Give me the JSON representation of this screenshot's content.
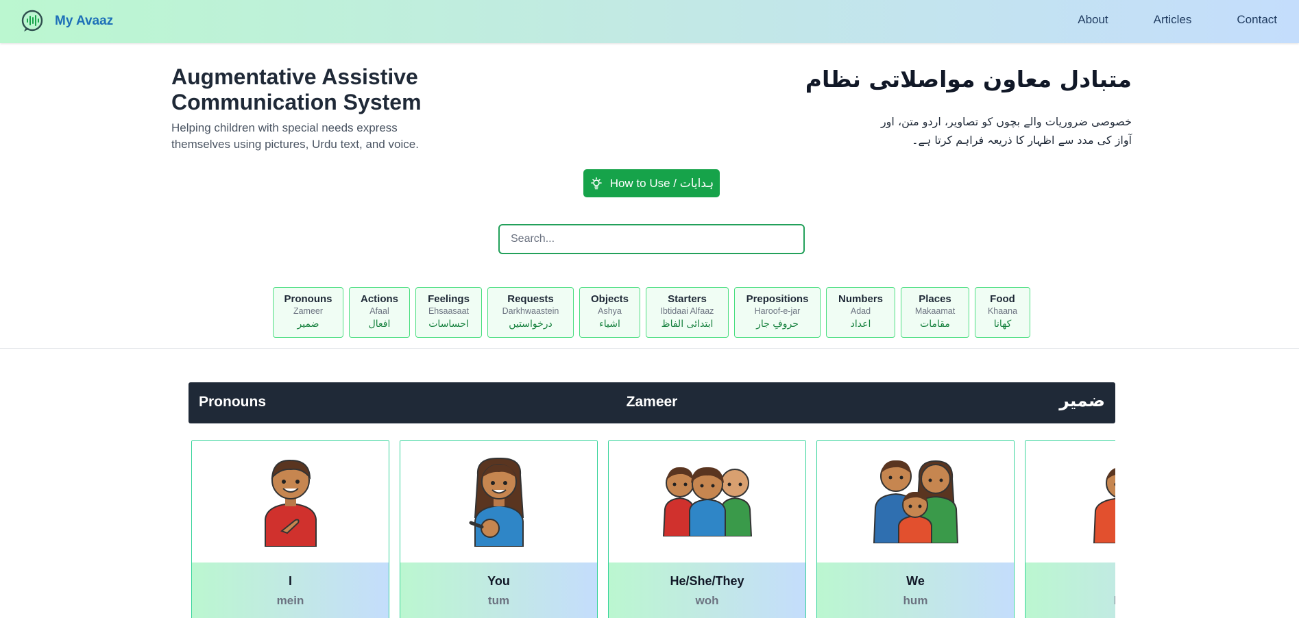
{
  "nav": {
    "brand": "My Avaaz",
    "links": [
      "About",
      "Articles",
      "Contact"
    ]
  },
  "hero": {
    "title": "Augmentative Assistive Communication System",
    "subtitle": "Helping children with special needs express themselves using pictures, Urdu text, and voice.",
    "urdu_title": "متبادل معاون مواصلاتی نظام",
    "urdu_subtitle": "خصوصی ضروریات والے بچوں کو تصاویر، اردو متن، اور آواز کی مدد سے اظہار کا ذریعہ فراہم کرتا ہے۔",
    "howto_label": "How to Use / ہدایات"
  },
  "search": {
    "placeholder": "Search..."
  },
  "categories": [
    {
      "en": "Pronouns",
      "tr": "Zameer",
      "ur": "ضمیر"
    },
    {
      "en": "Actions",
      "tr": "Afaal",
      "ur": "افعال"
    },
    {
      "en": "Feelings",
      "tr": "Ehsaasaat",
      "ur": "احساسات"
    },
    {
      "en": "Requests",
      "tr": "Darkhwaastein",
      "ur": "درخواستیں"
    },
    {
      "en": "Objects",
      "tr": "Ashya",
      "ur": "اشیاء"
    },
    {
      "en": "Starters",
      "tr": "Ibtidaai Alfaaz",
      "ur": "ابتدائی الفاظ"
    },
    {
      "en": "Prepositions",
      "tr": "Haroof-e-jar",
      "ur": "حروفِ جار"
    },
    {
      "en": "Numbers",
      "tr": "Adad",
      "ur": "اعداد"
    },
    {
      "en": "Places",
      "tr": "Makaamat",
      "ur": "مقامات"
    },
    {
      "en": "Food",
      "tr": "Khaana",
      "ur": "کھانا"
    }
  ],
  "section": {
    "en": "Pronouns",
    "tr": "Zameer",
    "ur": "ضمیر"
  },
  "cards": [
    {
      "en": "I",
      "tr": "mein"
    },
    {
      "en": "You",
      "tr": "tum"
    },
    {
      "en": "He/She/They",
      "tr": "woh"
    },
    {
      "en": "We",
      "tr": "hum"
    },
    {
      "en": "C",
      "tr": "bac"
    }
  ],
  "colors": {
    "accent_green": "#16a34a",
    "section_bg": "#1f2937",
    "brand_blue": "#1d6fb8"
  }
}
